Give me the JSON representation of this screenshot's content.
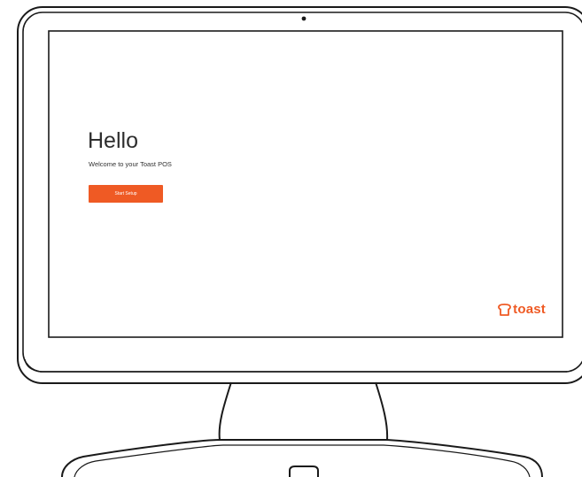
{
  "colors": {
    "accent": "#ef5a24",
    "text_dark": "#2e2e2e",
    "device_outline": "#1a1a1a",
    "screen_background": "#ffffff"
  },
  "screen": {
    "greeting": "Hello",
    "subtitle": "Welcome to your Toast POS",
    "start_button_label": "Start Setup"
  },
  "brand": {
    "icon": "toast-bread-icon",
    "name": "toast"
  },
  "device": {
    "camera_icon": "camera-dot-icon",
    "stand_icon": "tablet-stand"
  }
}
